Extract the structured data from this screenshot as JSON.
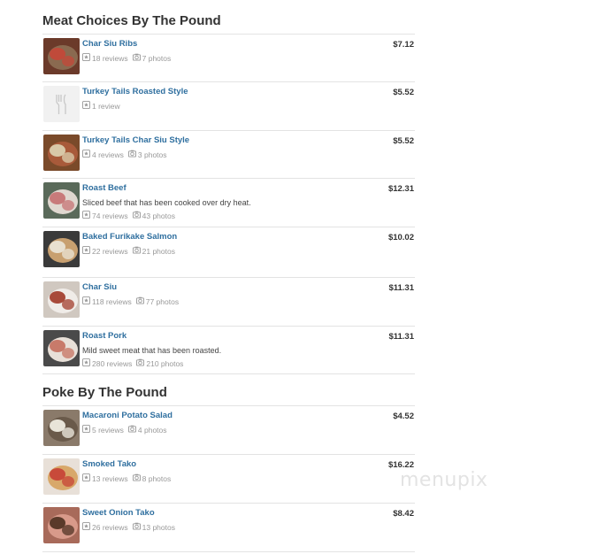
{
  "sections": [
    {
      "title": "Meat Choices By The Pound",
      "items": [
        {
          "name": "Char Siu Ribs",
          "desc": "",
          "reviews": "18 reviews",
          "photos": "7 photos",
          "price": "$7.12",
          "thumb_colors": [
            "#6b3a2a",
            "#c04a3a",
            "#8a6a50"
          ]
        },
        {
          "name": "Turkey Tails Roasted Style",
          "desc": "",
          "reviews": "1 review",
          "photos": "",
          "price": "$5.52",
          "thumb_colors": []
        },
        {
          "name": "Turkey Tails Char Siu Style",
          "desc": "",
          "reviews": "4 reviews",
          "photos": "3 photos",
          "price": "$5.52",
          "thumb_colors": [
            "#7a4a2a",
            "#d8c8a8",
            "#a85a3a"
          ]
        },
        {
          "name": "Roast Beef",
          "desc": "Sliced beef that has been cooked over dry heat.",
          "reviews": "74 reviews",
          "photos": "43 photos",
          "price": "$12.31",
          "thumb_colors": [
            "#5a6a5a",
            "#c87a7a",
            "#e0d8d0"
          ]
        },
        {
          "name": "Baked Furikake Salmon",
          "desc": "",
          "reviews": "22 reviews",
          "photos": "21 photos",
          "price": "$10.02",
          "thumb_colors": [
            "#3a3a3a",
            "#e8e0d0",
            "#c8a070"
          ]
        },
        {
          "name": "Char Siu",
          "desc": "",
          "reviews": "118 reviews",
          "photos": "77 photos",
          "price": "$11.31",
          "thumb_colors": [
            "#d0c8c0",
            "#a84a3a",
            "#f0ece8"
          ]
        },
        {
          "name": "Roast Pork",
          "desc": "Mild sweet meat that has been roasted.",
          "reviews": "280 reviews",
          "photos": "210 photos",
          "price": "$11.31",
          "thumb_colors": [
            "#4a4a4a",
            "#c87a6a",
            "#e8e0d8"
          ]
        }
      ]
    },
    {
      "title": "Poke By The Pound",
      "items": [
        {
          "name": "Macaroni Potato Salad",
          "desc": "",
          "reviews": "5 reviews",
          "photos": "4 photos",
          "price": "$4.52",
          "thumb_colors": [
            "#8a7a6a",
            "#e8e4d8",
            "#6a5a4a"
          ]
        },
        {
          "name": "Smoked Tako",
          "desc": "",
          "reviews": "13 reviews",
          "photos": "8 photos",
          "price": "$16.22",
          "thumb_colors": [
            "#e8e0d8",
            "#c84a3a",
            "#d8a86a"
          ]
        },
        {
          "name": "Sweet Onion Tako",
          "desc": "",
          "reviews": "26 reviews",
          "photos": "13 photos",
          "price": "$8.42",
          "thumb_colors": [
            "#a86a5a",
            "#5a3a2a",
            "#d89a8a"
          ]
        }
      ]
    }
  ],
  "watermark": "menupix"
}
